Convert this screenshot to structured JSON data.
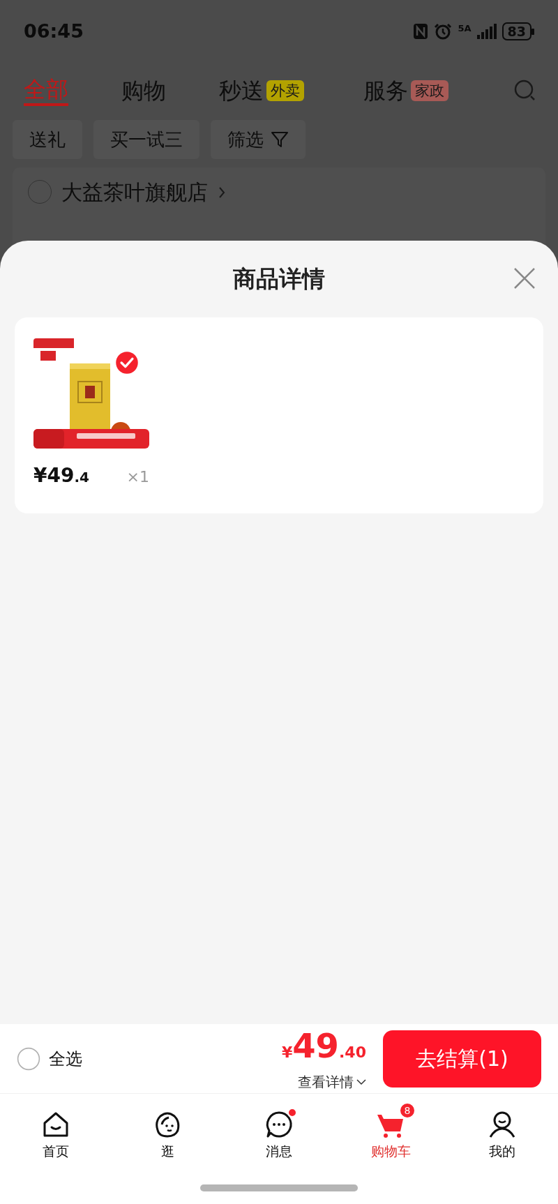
{
  "status_bar": {
    "time": "06:45",
    "network": "5A",
    "battery": "83"
  },
  "tabs": [
    {
      "label": "全部",
      "selected": true
    },
    {
      "label": "购物",
      "selected": false
    },
    {
      "label": "秒送",
      "selected": false,
      "badge": "外卖",
      "color": "#b3a200"
    },
    {
      "label": "服务",
      "selected": false,
      "badge": "家政",
      "color": "#a85a56"
    }
  ],
  "chips": [
    {
      "label": "送礼",
      "kind": "plain"
    },
    {
      "label": "买一试三",
      "kind": "plain"
    },
    {
      "label": "筛选",
      "kind": "filter"
    }
  ],
  "store": {
    "name": "大益茶叶旗舰店",
    "checked": false
  },
  "sheet": {
    "title": "商品详情",
    "items": [
      {
        "kind": "picture",
        "checked": true,
        "price_integer": "¥49",
        "price_decimal": ".4",
        "quantity": "×1"
      }
    ]
  },
  "footer": {
    "select_all": {
      "label": "全选",
      "checked": false
    },
    "currency": "¥",
    "total_integer": "49",
    "total_decimal": ".40",
    "details": "查看详情",
    "checkout": "去结算(1)"
  },
  "nav": [
    {
      "kind": "home",
      "label": "首页",
      "selected": false
    },
    {
      "kind": "browse",
      "label": "逛",
      "selected": false
    },
    {
      "kind": "message",
      "label": "消息",
      "selected": false,
      "dot": true
    },
    {
      "kind": "cart",
      "label": "购物车",
      "selected": true,
      "badge": "8"
    },
    {
      "kind": "profile",
      "label": "我的",
      "selected": false
    }
  ]
}
